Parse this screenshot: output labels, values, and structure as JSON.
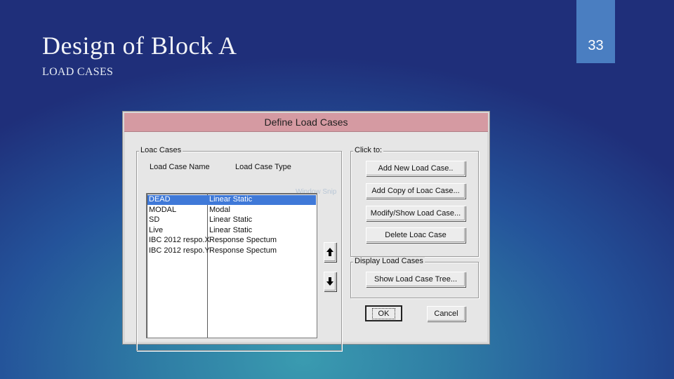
{
  "slide": {
    "title": "Design of Block A",
    "subtitle": "LOAD CASES",
    "page_number": "33"
  },
  "dialog": {
    "title": "Define Load Cases",
    "load_cases_group": {
      "legend": "Loac Cases",
      "col_name": "Load Case Name",
      "col_type": "Load Case Type",
      "rows": [
        {
          "name": "DEAD",
          "type": "Linear Static",
          "selected": true
        },
        {
          "name": "MODAL",
          "type": "Modal",
          "selected": false
        },
        {
          "name": "SD",
          "type": "Linear Static",
          "selected": false
        },
        {
          "name": "Live",
          "type": "Linear Static",
          "selected": false
        },
        {
          "name": "IBC 2012 respo.X",
          "type": "Response Spectum",
          "selected": false
        },
        {
          "name": "IBC 2012 respo.Y",
          "type": "Response Spectum",
          "selected": false
        }
      ],
      "move_up_icon": "arrow-up-icon",
      "move_down_icon": "arrow-down-icon"
    },
    "ghost_text": "Window Snip",
    "click_to_group": {
      "legend": "Click to:",
      "buttons": [
        "Add New Load Case..",
        "Add Copy of Loac Case...",
        "Modify/Show Load Case...",
        "Delete Loac Case"
      ]
    },
    "display_group": {
      "legend": "Display Load Cases",
      "button": "Show Load Case Tree..."
    },
    "ok_label": "OK",
    "cancel_label": "Cancel"
  },
  "colors": {
    "titlebar": "#d59aa2",
    "selection": "#3f79d8",
    "page_tab": "#4a7ec1"
  }
}
